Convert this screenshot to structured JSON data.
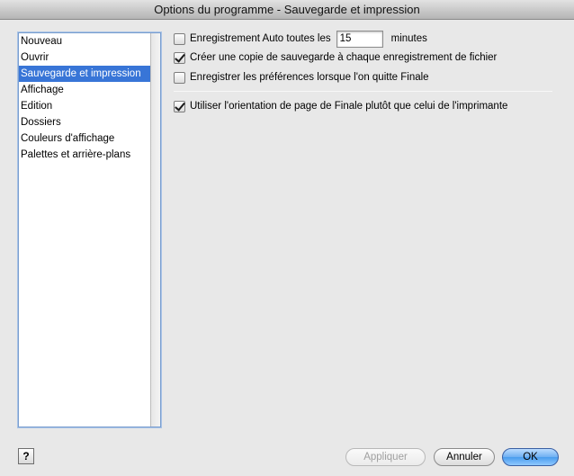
{
  "window": {
    "title": "Options du programme - Sauvegarde et impression"
  },
  "sidebar": {
    "items": [
      {
        "label": "Nouveau",
        "selected": false
      },
      {
        "label": "Ouvrir",
        "selected": false
      },
      {
        "label": "Sauvegarde et impression",
        "selected": true
      },
      {
        "label": "Affichage",
        "selected": false
      },
      {
        "label": "Edition",
        "selected": false
      },
      {
        "label": "Dossiers",
        "selected": false
      },
      {
        "label": "Couleurs d'affichage",
        "selected": false
      },
      {
        "label": "Palettes et arrière-plans",
        "selected": false
      }
    ]
  },
  "options": {
    "autosave": {
      "label": "Enregistrement Auto toutes les",
      "checked": false,
      "value": "15",
      "unit": "minutes"
    },
    "backup_copy": {
      "label": "Créer une copie de sauvegarde à chaque enregistrement de fichier",
      "checked": true
    },
    "save_prefs": {
      "label": "Enregistrer les préférences lorsque l'on quitte Finale",
      "checked": false
    },
    "page_orientation": {
      "label": "Utiliser l'orientation de page de Finale plutôt que celui de l'imprimante",
      "checked": true
    }
  },
  "footer": {
    "help_label": "?",
    "apply_label": "Appliquer",
    "cancel_label": "Annuler",
    "ok_label": "OK"
  },
  "colors": {
    "selection": "#3875d7",
    "default_button": "#4a9cee"
  }
}
